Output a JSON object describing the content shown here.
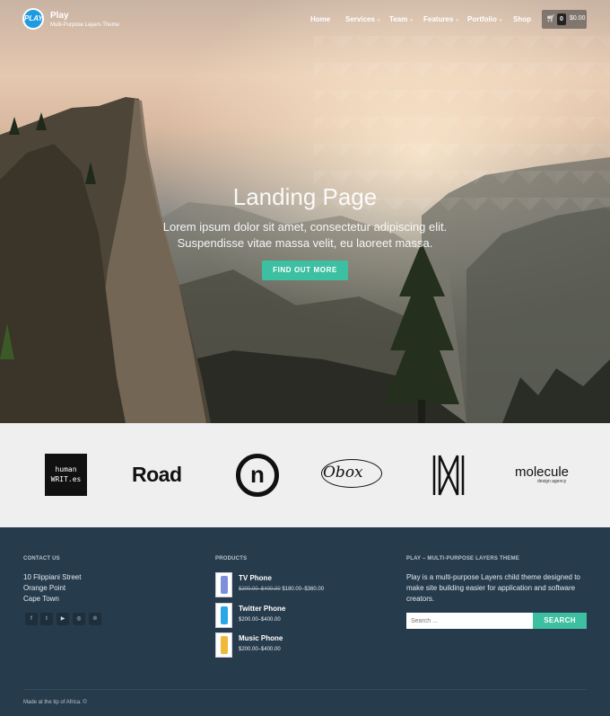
{
  "header": {
    "logo_text": "PLAY",
    "brand_name": "Play",
    "brand_tagline": "Multi-Purpose Layers Theme",
    "nav": [
      {
        "label": "Home",
        "has_dropdown": false
      },
      {
        "label": "Services",
        "has_dropdown": true
      },
      {
        "label": "Team",
        "has_dropdown": true
      },
      {
        "label": "Features",
        "has_dropdown": true
      },
      {
        "label": "Portfolio",
        "has_dropdown": true
      },
      {
        "label": "Shop",
        "has_dropdown": false
      }
    ],
    "cart": {
      "icon": "cart-icon",
      "count": "0",
      "total": "$0.00"
    }
  },
  "hero": {
    "title": "Landing Page",
    "subtitle_line1": "Lorem ipsum dolor sit amet, consectetur adipiscing elit.",
    "subtitle_line2": "Suspendisse vitae massa velit, eu laoreet massa.",
    "button_label": "FIND OUT MORE",
    "accent_color": "#3dbfa1"
  },
  "client_logos": {
    "human_writes": "human WRIT.es",
    "road": "Road",
    "n_logo": "n",
    "obox": "Obox",
    "h_logo": "H",
    "molecule": "molecule",
    "molecule_sub": "design agency"
  },
  "footer": {
    "contact": {
      "heading": "CONTACT US",
      "line1": "10 Flippiani Street",
      "line2": "Orange Point",
      "line3": "Cape Town",
      "social_icons": [
        "facebook-icon",
        "twitter-icon",
        "youtube-icon",
        "dribbble-icon",
        "pinterest-icon"
      ]
    },
    "products": {
      "heading": "PRODUCTS",
      "items": [
        {
          "name": "TV Phone",
          "old_price": "$200.00–$400.00",
          "price": "$180.00–$360.00",
          "color": "#7d8fd8"
        },
        {
          "name": "Twitter Phone",
          "price": "$200.00–$400.00",
          "color": "#2aa7e8"
        },
        {
          "name": "Music Phone",
          "price": "$200.00–$400.00",
          "color": "#f0b93a"
        }
      ]
    },
    "about": {
      "heading": "PLAY – MULTI-PURPOSE LAYERS THEME",
      "line1": "Play is a multi-purpose Layers child theme designed to",
      "line2": "make site building easier for application and software",
      "line3": "creators.",
      "search_placeholder": "Search ...",
      "search_button": "SEARCH"
    },
    "copyright": "Made at the tip of Africa. ©"
  }
}
